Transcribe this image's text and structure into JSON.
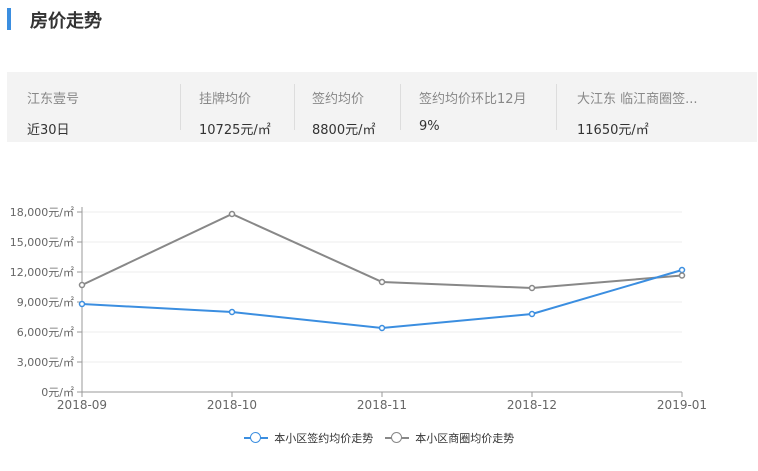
{
  "header": {
    "title": "房价走势",
    "accent_color": "#3b8ee0"
  },
  "summary": {
    "columns": [
      {
        "label": "江东壹号",
        "value": "近30日"
      },
      {
        "label": "挂牌均价",
        "value": "10725元/㎡"
      },
      {
        "label": "签约均价",
        "value": "8800元/㎡"
      },
      {
        "label": "签约均价环比12月",
        "value": "9%"
      },
      {
        "label": "大江东 临江商圈签...",
        "value": "11650元/㎡"
      }
    ]
  },
  "chart_data": {
    "type": "line",
    "categories": [
      "2018-09",
      "2018-10",
      "2018-11",
      "2018-12",
      "2019-01"
    ],
    "ylim": [
      0,
      18000
    ],
    "yticks": [
      0,
      3000,
      6000,
      9000,
      12000,
      15000,
      18000
    ],
    "ytick_labels": [
      "0元/㎡",
      "3,000元/㎡",
      "6,000元/㎡",
      "9,000元/㎡",
      "12,000元/㎡",
      "15,000元/㎡",
      "18,000元/㎡"
    ],
    "grid": true,
    "legend_position": "bottom-center",
    "series": [
      {
        "name": "本小区签约均价走势",
        "color": "#3b8ee0",
        "values": [
          8800,
          8000,
          6400,
          7800,
          12200
        ]
      },
      {
        "name": "本小区商圈均价走势",
        "color": "#888888",
        "values": [
          10700,
          17800,
          11000,
          10400,
          11650
        ]
      }
    ]
  }
}
